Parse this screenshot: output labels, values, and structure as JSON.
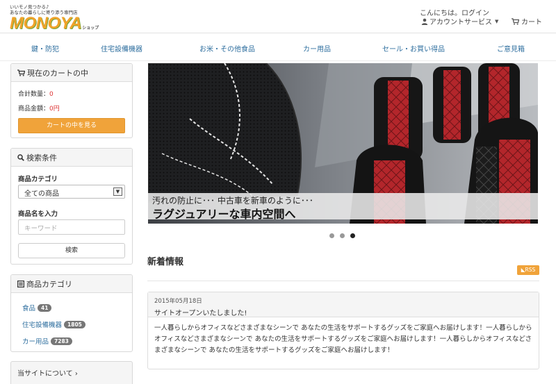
{
  "header": {
    "tagline_line1": "いいモノ見つかる♪",
    "tagline_line2": "あなたの暮らしに寄り添う専門店",
    "logo_text": "MONOYA",
    "logo_sub": "ショップ",
    "greeting": "こんにちは。ログイン",
    "account_label": "アカウントサービス",
    "cart_label": "カート"
  },
  "nav": {
    "items": [
      "鍵・防犯",
      "住宅設備機器",
      "お米・その他食品",
      "カー用品",
      "セール・お買い得品",
      "ご意見箱"
    ]
  },
  "cart_panel": {
    "title": "現在のカートの中",
    "qty_label": "合計数量：",
    "qty_value": "0",
    "amount_label": "商品金額：",
    "amount_value": "0円",
    "view_button": "カートの中を見る"
  },
  "search_panel": {
    "title": "検索条件",
    "category_label": "商品カテゴリ",
    "category_selected": "全ての商品",
    "name_label": "商品名を入力",
    "keyword_placeholder": "キーワード",
    "search_button": "検索"
  },
  "category_panel": {
    "title": "商品カテゴリ",
    "items": [
      {
        "label": "食品",
        "count": "41"
      },
      {
        "label": "住宅設備機器",
        "count": "1805"
      },
      {
        "label": "カー用品",
        "count": "7283"
      }
    ]
  },
  "about_panel": {
    "title": "当サイトについて"
  },
  "carousel": {
    "caption_line1": "汚れの防止に･･･ 中古車を新車のように･･･",
    "caption_line2": "ラグジュアリーな車内空間へ",
    "slide_count": 3,
    "active_slide": 3
  },
  "news": {
    "title": "新着情報",
    "rss_label": "RSS",
    "entry": {
      "date": "2015年05月18日",
      "headline": "サイトオープンいたしました!",
      "body": "一人暮らしからオフィスなどさまざまなシーンで あなたの生活をサポートするグッズをご家庭へお届けします！一人暮らしからオフィスなどさまざまなシーンで あなたの生活をサポートするグッズをご家庭へお届けします！一人暮らしからオフィスなどさまざまなシーンで あなたの生活をサポートするグッズをご家庭へお届けします！"
    }
  },
  "colors": {
    "accent_orange": "#f0a33a",
    "link_blue": "#2f6f9f",
    "price_red": "#dd3333"
  }
}
